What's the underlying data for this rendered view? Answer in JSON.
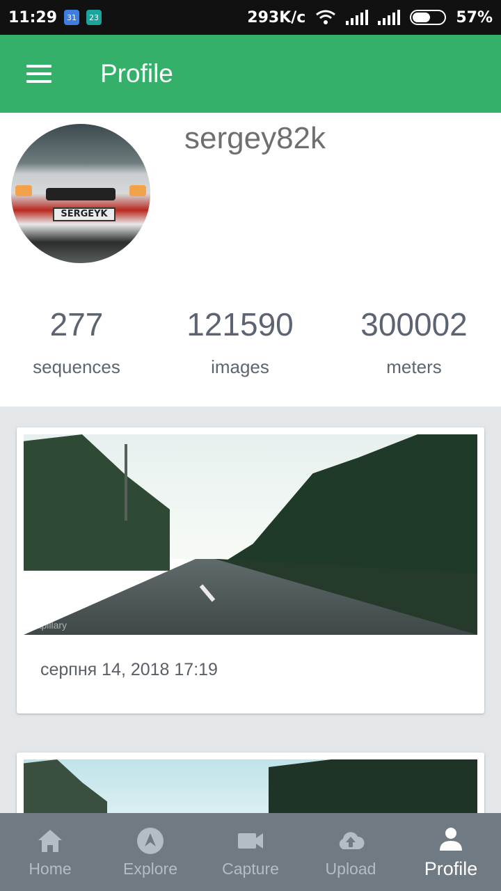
{
  "statusbar": {
    "time": "11:29",
    "mini_icons": [
      "31",
      "23"
    ],
    "speed": "293K/c",
    "battery": "57%",
    "battery_level": 0.57,
    "icons": [
      "calendar-icon",
      "notification-icon",
      "wifi-icon",
      "signal-icon",
      "signal-icon",
      "battery-icon"
    ]
  },
  "appbar": {
    "title": "Profile",
    "menu_icon": "menu-icon",
    "color": "#35b06a"
  },
  "profile": {
    "username": "sergey82k",
    "avatar_plate": "SERGEYK",
    "stats": [
      {
        "value": "277",
        "label": "sequences"
      },
      {
        "value": "121590",
        "label": "images"
      },
      {
        "value": "300002",
        "label": "meters"
      }
    ]
  },
  "sequences": [
    {
      "date": "серпня 14, 2018 17:19",
      "watermark": "Mapillary"
    },
    {
      "date": ""
    }
  ],
  "nav": {
    "items": [
      {
        "label": "Home",
        "icon": "home-icon"
      },
      {
        "label": "Explore",
        "icon": "compass-icon"
      },
      {
        "label": "Capture",
        "icon": "video-camera-icon"
      },
      {
        "label": "Upload",
        "icon": "cloud-upload-icon"
      },
      {
        "label": "Profile",
        "icon": "person-icon",
        "active": true
      }
    ],
    "background": "#6f7a82"
  }
}
